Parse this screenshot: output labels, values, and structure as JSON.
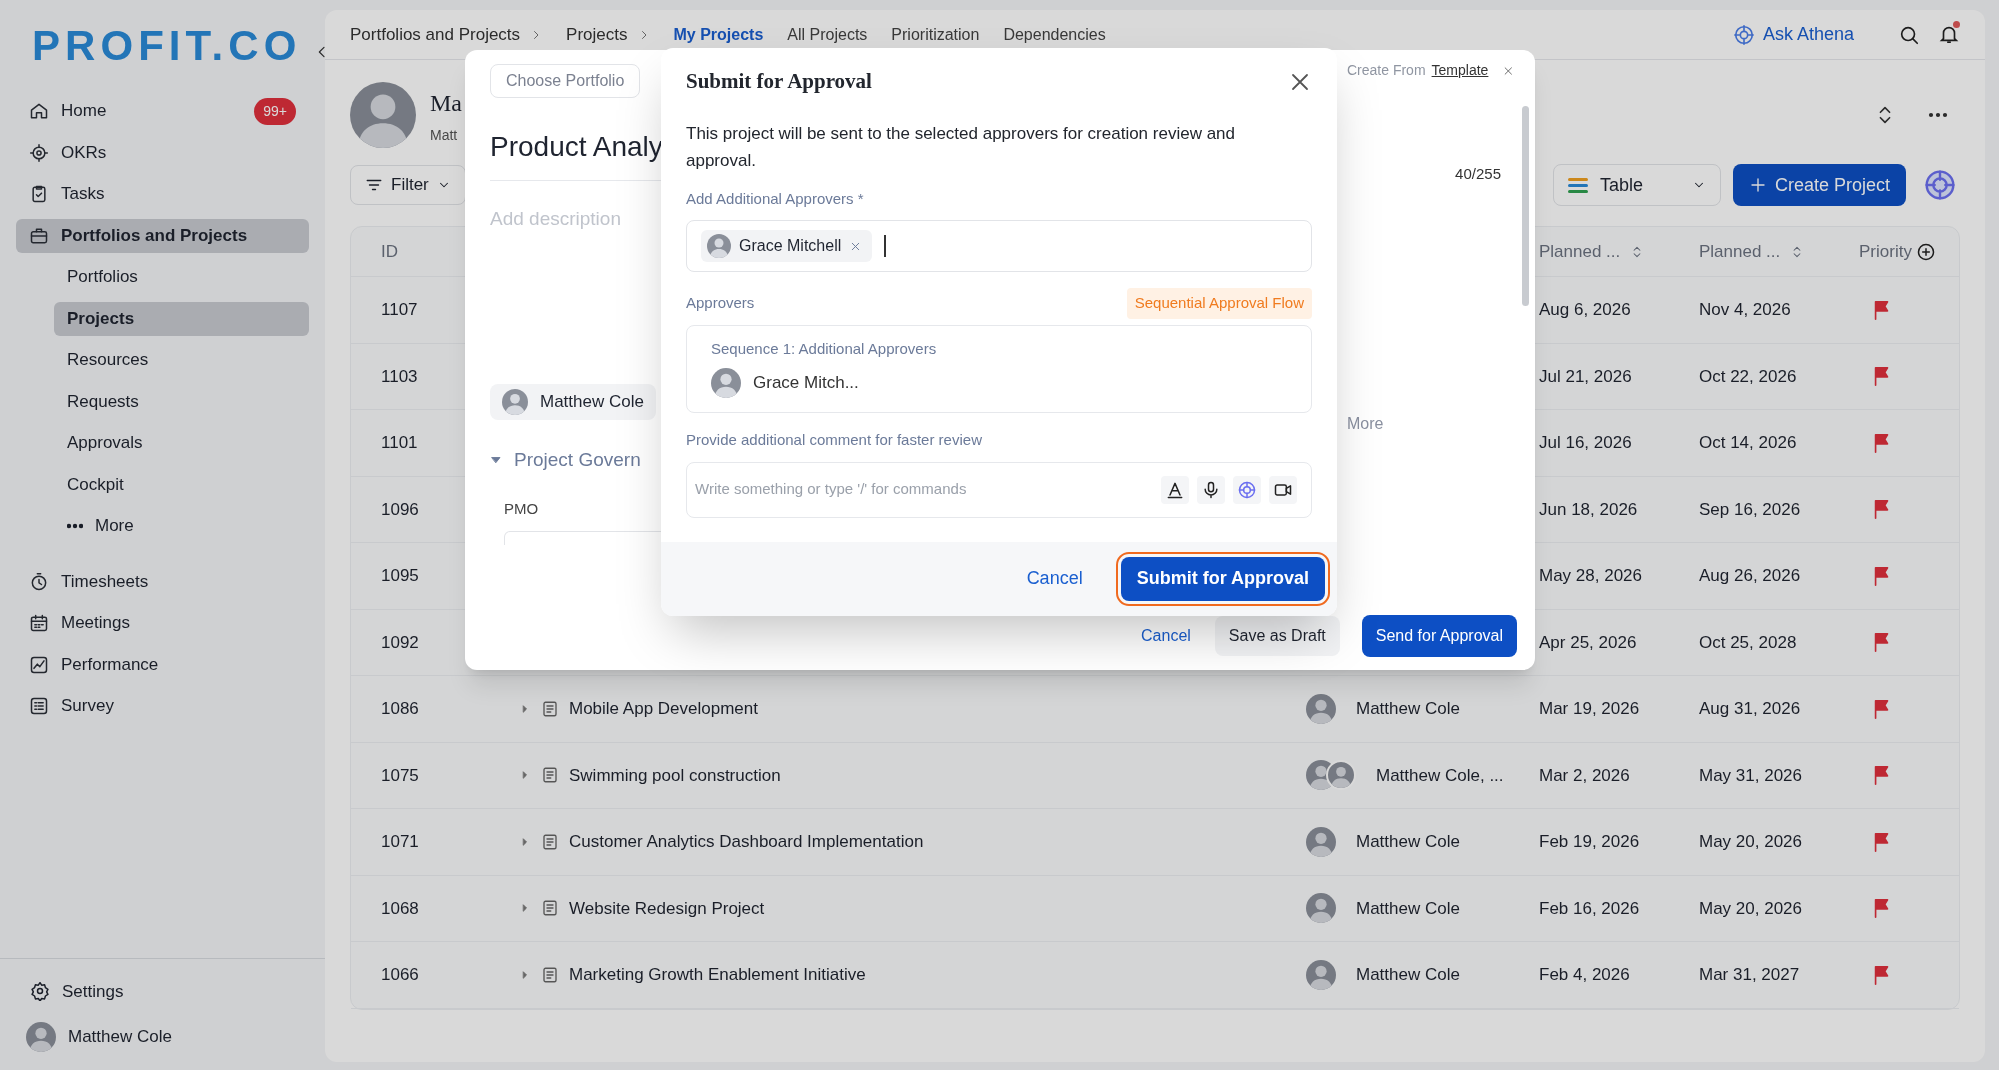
{
  "sidebar": {
    "logo": "PROFIT.CO",
    "nav": [
      {
        "label": "Home",
        "badge": "99+",
        "selected": false
      },
      {
        "label": "OKRs",
        "selected": false
      },
      {
        "label": "Tasks",
        "selected": false
      },
      {
        "label": "Portfolios and Projects",
        "selected": true,
        "children": [
          {
            "label": "Portfolios",
            "selected": false
          },
          {
            "label": "Projects",
            "selected": true
          },
          {
            "label": "Resources",
            "selected": false
          },
          {
            "label": "Requests",
            "selected": false
          },
          {
            "label": "Approvals",
            "selected": false
          },
          {
            "label": "Cockpit",
            "selected": false
          },
          {
            "label": "More",
            "kind": "more",
            "selected": false
          }
        ]
      },
      {
        "label": "Timesheets",
        "selected": false
      },
      {
        "label": "Meetings",
        "selected": false
      },
      {
        "label": "Performance",
        "selected": false
      },
      {
        "label": "Survey",
        "selected": false
      }
    ],
    "settings": "Settings",
    "user": "Matthew Cole"
  },
  "header": {
    "breadcrumb": [
      "Portfolios and Projects",
      "Projects"
    ],
    "tabs": [
      {
        "label": "My Projects",
        "selected": true
      },
      {
        "label": "All Projects",
        "selected": false
      },
      {
        "label": "Prioritization",
        "selected": false
      },
      {
        "label": "Dependencies",
        "selected": false
      }
    ],
    "ask": "Ask Athena",
    "has_notification": true
  },
  "profile": {
    "name": "Ma",
    "subtitle": "Matt"
  },
  "toolbar": {
    "filter": "Filter",
    "view": "Table",
    "create": "Create Project"
  },
  "table": {
    "columns": [
      {
        "label": "ID",
        "sortable": false
      },
      {
        "label": "Planned ...",
        "sortable": true
      },
      {
        "label": "Planned ...",
        "sortable": true
      },
      {
        "label": "Priority",
        "sortable": false
      }
    ],
    "rows": [
      {
        "id": "1107",
        "start": "Aug 6, 2026",
        "end": "Nov 4, 2026",
        "flag": true
      },
      {
        "id": "1103",
        "start": "Jul 21, 2026",
        "end": "Oct 22, 2026",
        "flag": true
      },
      {
        "id": "1101",
        "start": "Jul 16, 2026",
        "end": "Oct 14, 2026",
        "flag": true
      },
      {
        "id": "1096",
        "start": "Jun 18, 2026",
        "end": "Sep 16, 2026",
        "flag": true
      },
      {
        "id": "1095",
        "start": "May 28, 2026",
        "end": "Aug 26, 2026",
        "flag": true
      },
      {
        "id": "1092",
        "start": "Apr 25, 2026",
        "end": "Oct 25, 2028",
        "flag": true
      },
      {
        "id": "1086",
        "name": "Mobile App Development",
        "owner": "Matthew Cole",
        "co_owner": false,
        "start": "Mar 19, 2026",
        "end": "Aug 31, 2026",
        "flag": true
      },
      {
        "id": "1075",
        "name": "Swimming pool construction",
        "owner": "Matthew Cole, ...",
        "co_owner": true,
        "start": "Mar 2, 2026",
        "end": "May 31, 2026",
        "flag": true
      },
      {
        "id": "1071",
        "name": "Customer Analytics Dashboard Implementation",
        "owner": "Matthew Cole",
        "co_owner": false,
        "start": "Feb 19, 2026",
        "end": "May 20, 2026",
        "flag": true
      },
      {
        "id": "1068",
        "name": "Website Redesign Project",
        "owner": "Matthew Cole",
        "co_owner": false,
        "start": "Feb 16, 2026",
        "end": "May 20, 2026",
        "flag": true
      },
      {
        "id": "1066",
        "name": "Marketing Growth Enablement Initiative",
        "owner": "Matthew Cole",
        "co_owner": false,
        "start": "Feb 4, 2026",
        "end": "Mar 31, 2027",
        "flag": true
      }
    ]
  },
  "create_form": {
    "portfolio_placeholder": "Choose Portfolio",
    "title": "Product Analy",
    "description_placeholder": "Add description",
    "template_prefix": "Create From",
    "template_link": "Template",
    "char_count": "40/255",
    "owner": "Matthew Cole",
    "more": "More",
    "section": "Project Govern",
    "section_expanded": true,
    "field_label": "PMO",
    "cancel": "Cancel",
    "draft": "Save as Draft",
    "send": "Send for Approval"
  },
  "approval_dialog": {
    "title": "Submit for Approval",
    "message": "This project will be sent to the selected approvers for creation review and approval.",
    "approvers_label": "Add Additional Approvers *",
    "selected_approvers": [
      "Grace Mitchell"
    ],
    "approvers_heading": "Approvers",
    "flow_badge": "Sequential Approval Flow",
    "sequences": [
      {
        "label": "Sequence 1: Additional Approvers",
        "approvers": [
          "Grace Mitch..."
        ]
      }
    ],
    "comment_label": "Provide additional comment for faster review",
    "comment_placeholder": "Write something or type '/' for commands",
    "cancel": "Cancel",
    "submit": "Submit for Approval",
    "submit_highlighted": true
  }
}
